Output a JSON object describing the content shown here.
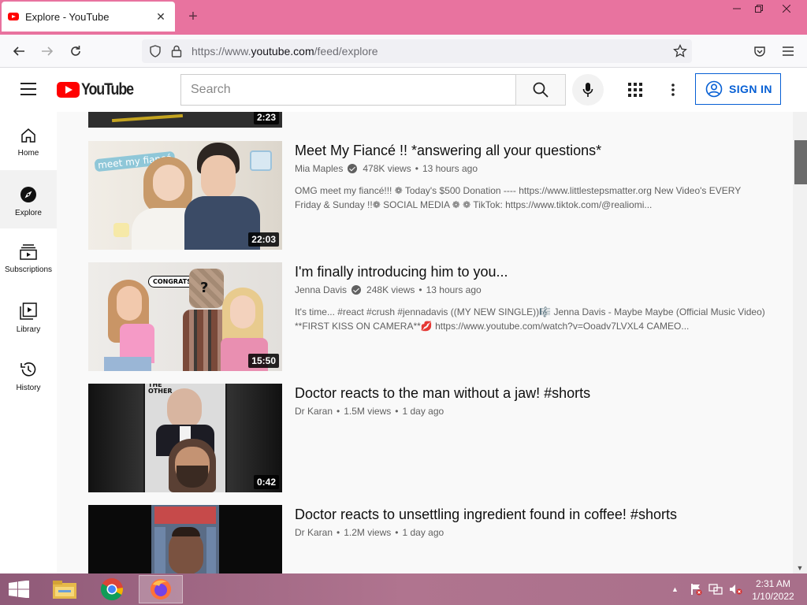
{
  "browser": {
    "tab_title": "Explore - YouTube",
    "url_prefix": "https://www.",
    "url_host": "youtube.com",
    "url_path": "/feed/explore",
    "new_tab": "+"
  },
  "header": {
    "logo_text": "YouTube",
    "search_placeholder": "Search",
    "signin_label": "SIGN IN"
  },
  "sidebar": {
    "items": [
      {
        "label": "Home",
        "icon": "home-icon"
      },
      {
        "label": "Explore",
        "icon": "compass-icon",
        "active": true
      },
      {
        "label": "Subscriptions",
        "icon": "subscriptions-icon"
      },
      {
        "label": "Library",
        "icon": "library-icon"
      },
      {
        "label": "History",
        "icon": "history-icon"
      }
    ]
  },
  "videos": [
    {
      "duration": "2:23"
    },
    {
      "title": "Meet My Fiancé !! *answering all your questions*",
      "channel": "Mia Maples",
      "verified": true,
      "views": "478K views",
      "age": "13 hours ago",
      "desc1": "OMG meet my fiancé!!! ❁ Today's $500 Donation ---- https://www.littlestepsmatter.org New Video's EVERY",
      "desc2": "Friday & Sunday !!❁ SOCIAL MEDIA ❁ ❁ TikTok: https://www.tiktok.com/@realiomi...",
      "duration": "22:03",
      "thumb_text": "meet my fiancé"
    },
    {
      "title": "I'm finally introducing him to you...",
      "channel": "Jenna Davis",
      "verified": true,
      "views": "248K views",
      "age": "13 hours ago",
      "desc1": "It's time... #react #crush #jennadavis ((MY NEW SINGLE))🎼 Jenna Davis - Maybe Maybe (Official Music Video)",
      "desc2": "**FIRST KISS ON CAMERA**💋 https://www.youtube.com/watch?v=Ooadv7LVXL4 CAMEO...",
      "duration": "15:50",
      "thumb_text": "CONGRATS"
    },
    {
      "title": "Doctor reacts to the man without a jaw! #shorts",
      "channel": "Dr Karan",
      "verified": false,
      "views": "1.5M views",
      "age": "1 day ago",
      "duration": "0:42",
      "thumb_text": "THE OTHER"
    },
    {
      "title": "Doctor reacts to unsettling ingredient found in coffee! #shorts",
      "channel": "Dr Karan",
      "verified": false,
      "views": "1.2M views",
      "age": "1 day ago"
    }
  ],
  "meta_separator": "•",
  "taskbar": {
    "time": "2:31 AM",
    "date": "1/10/2022"
  },
  "colors": {
    "tabstrip": "#e8739f",
    "yt_red": "#ff0000",
    "signin_blue": "#065fd4",
    "taskbar": "#a86f8a"
  }
}
